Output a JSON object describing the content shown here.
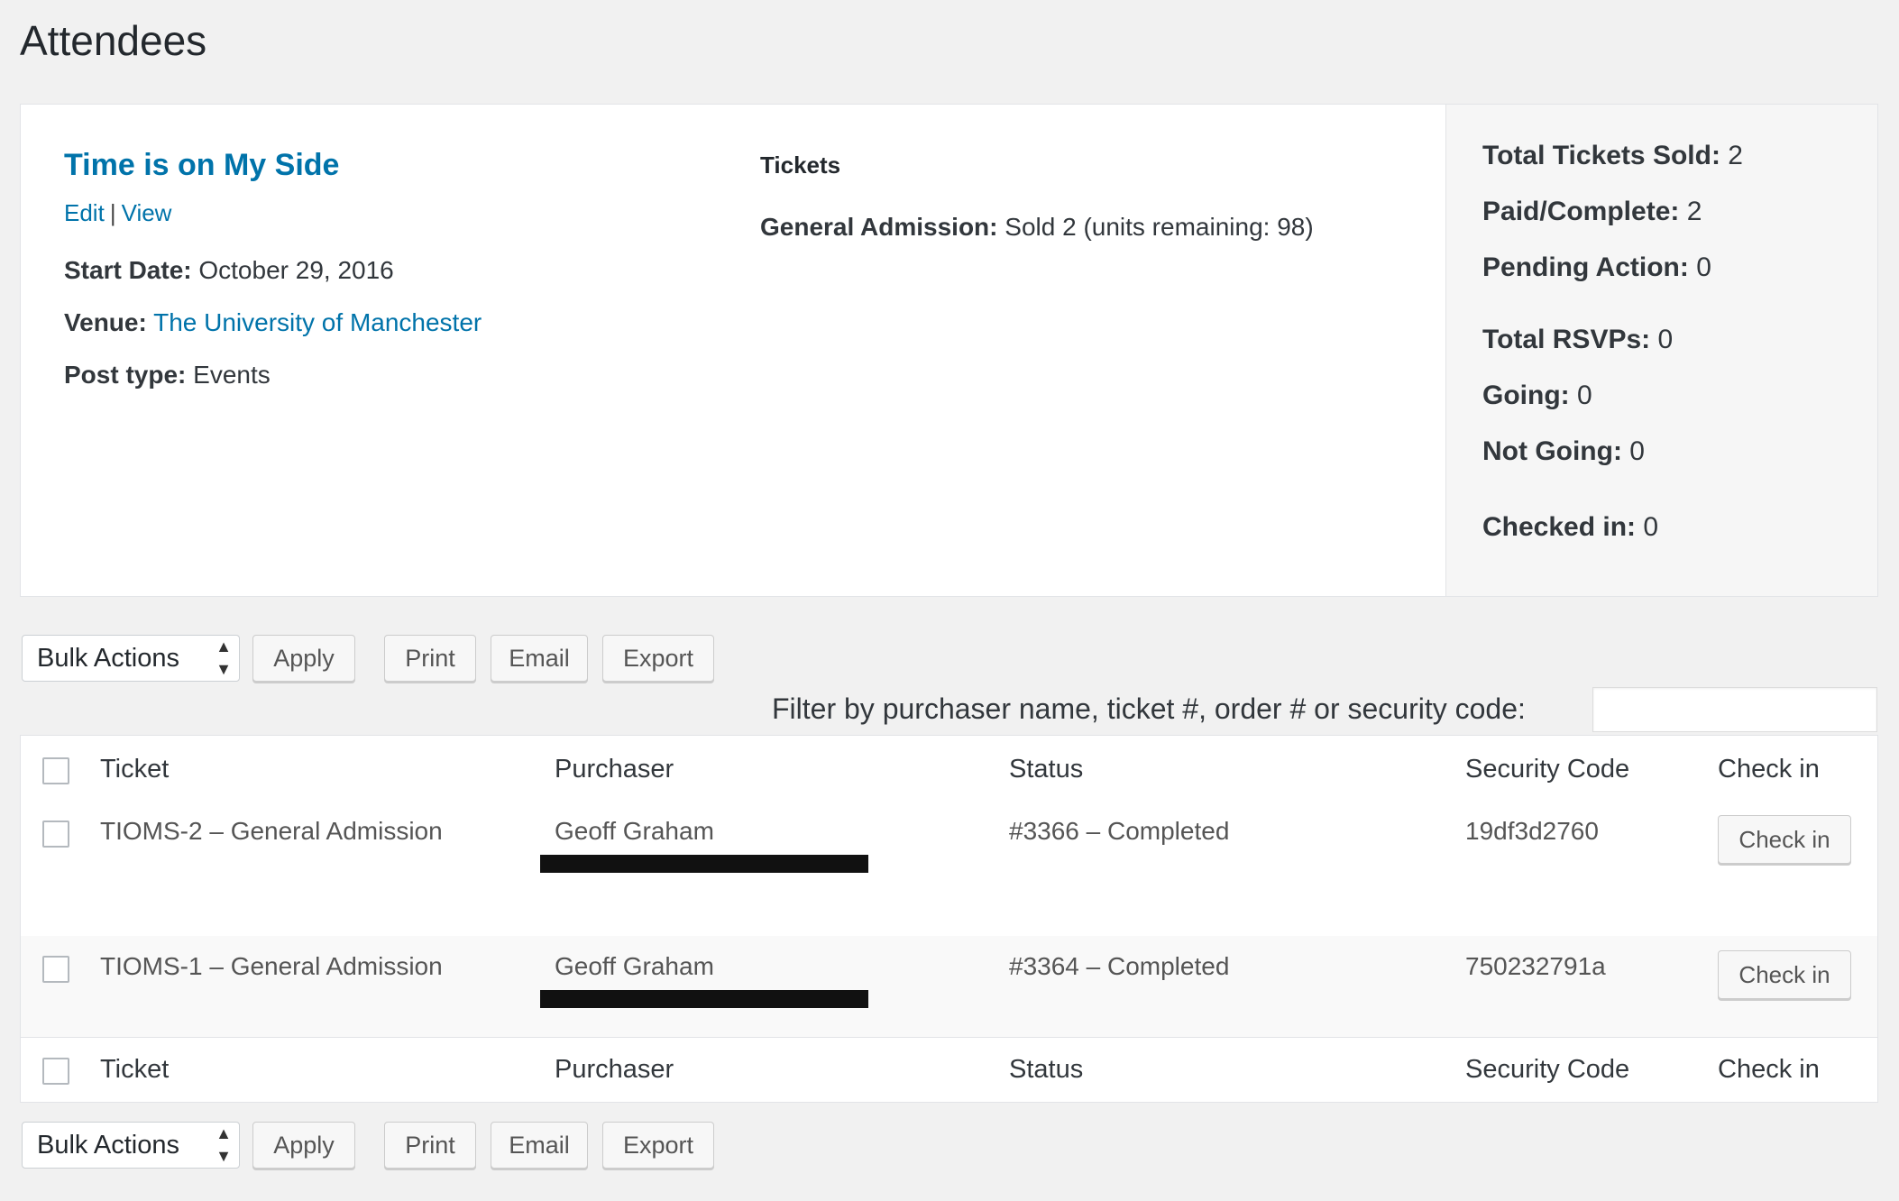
{
  "page_title": "Attendees",
  "event": {
    "title": "Time is on My Side",
    "edit_label": "Edit",
    "link_separator": "|",
    "view_label": "View",
    "start_date_label": "Start Date:",
    "start_date": "October 29, 2016",
    "venue_label": "Venue:",
    "venue": "The University of Manchester",
    "post_type_label": "Post type:",
    "post_type": "Events"
  },
  "tickets": {
    "heading": "Tickets",
    "ticket_name": "General Admission:",
    "ticket_detail": "Sold 2 (units remaining: 98)"
  },
  "stats": {
    "total_sold_label": "Total Tickets Sold:",
    "total_sold": "2",
    "paid_label": "Paid/Complete:",
    "paid": "2",
    "pending_label": "Pending Action:",
    "pending": "0",
    "rsvps_label": "Total RSVPs:",
    "rsvps": "0",
    "going_label": "Going:",
    "going": "0",
    "not_going_label": "Not Going:",
    "not_going": "0",
    "checked_in_label": "Checked in:",
    "checked_in": "0"
  },
  "toolbar": {
    "bulk_actions": "Bulk Actions",
    "apply": "Apply",
    "print": "Print",
    "email": "Email",
    "export": "Export"
  },
  "filter": {
    "label": "Filter by purchaser name, ticket #, order # or security code:",
    "value": ""
  },
  "table": {
    "columns": {
      "ticket": "Ticket",
      "purchaser": "Purchaser",
      "status": "Status",
      "security_code": "Security Code",
      "check_in": "Check in"
    },
    "rows": [
      {
        "ticket": "TIOMS-2 – General Admission",
        "purchaser": "Geoff Graham",
        "status": "#3366 – Completed",
        "security_code": "19df3d2760",
        "check_in_label": "Check in"
      },
      {
        "ticket": "TIOMS-1 – General Admission",
        "purchaser": "Geoff Graham",
        "status": "#3364 – Completed",
        "security_code": "750232791a",
        "check_in_label": "Check in"
      }
    ]
  },
  "colors": {
    "link": "#0073aa",
    "background": "#f1f1f1",
    "text": "#32373c"
  }
}
